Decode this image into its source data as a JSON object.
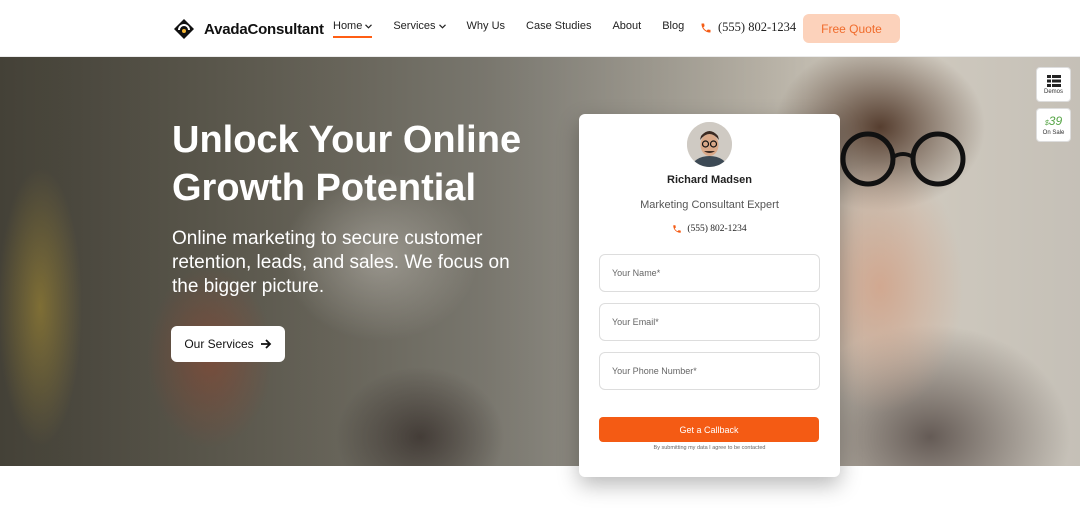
{
  "brand": {
    "name": "AvadaConsultant"
  },
  "nav": {
    "items": [
      {
        "label": "Home",
        "has_dropdown": true,
        "active": true
      },
      {
        "label": "Services",
        "has_dropdown": true,
        "active": false
      },
      {
        "label": "Why Us",
        "has_dropdown": false,
        "active": false
      },
      {
        "label": "Case Studies",
        "has_dropdown": false,
        "active": false
      },
      {
        "label": "About",
        "has_dropdown": false,
        "active": false
      },
      {
        "label": "Blog",
        "has_dropdown": false,
        "active": false
      }
    ]
  },
  "header": {
    "phone": "(555) 802-1234",
    "quote_label": "Free Quote"
  },
  "hero": {
    "title": "Unlock Your Online Growth Potential",
    "subtitle": "Online marketing to secure customer retention, leads, and sales. We focus on the bigger picture.",
    "cta_label": "Our Services"
  },
  "side": {
    "demos_label": "Demos",
    "sale_currency": "$",
    "sale_price": "39",
    "sale_label": "On Sale"
  },
  "form": {
    "name": "Richard Madsen",
    "role": "Marketing Consultant Expert",
    "phone": "(555) 802-1234",
    "name_placeholder": "Your Name*",
    "email_placeholder": "Your Email*",
    "phone_placeholder": "Your Phone Number*",
    "submit_label": "Get a Callback",
    "consent": "By submitting my data I agree to be contacted"
  },
  "colors": {
    "accent": "#f45b14",
    "quote_bg": "#fcd2bb",
    "sale_green": "#54a444"
  }
}
